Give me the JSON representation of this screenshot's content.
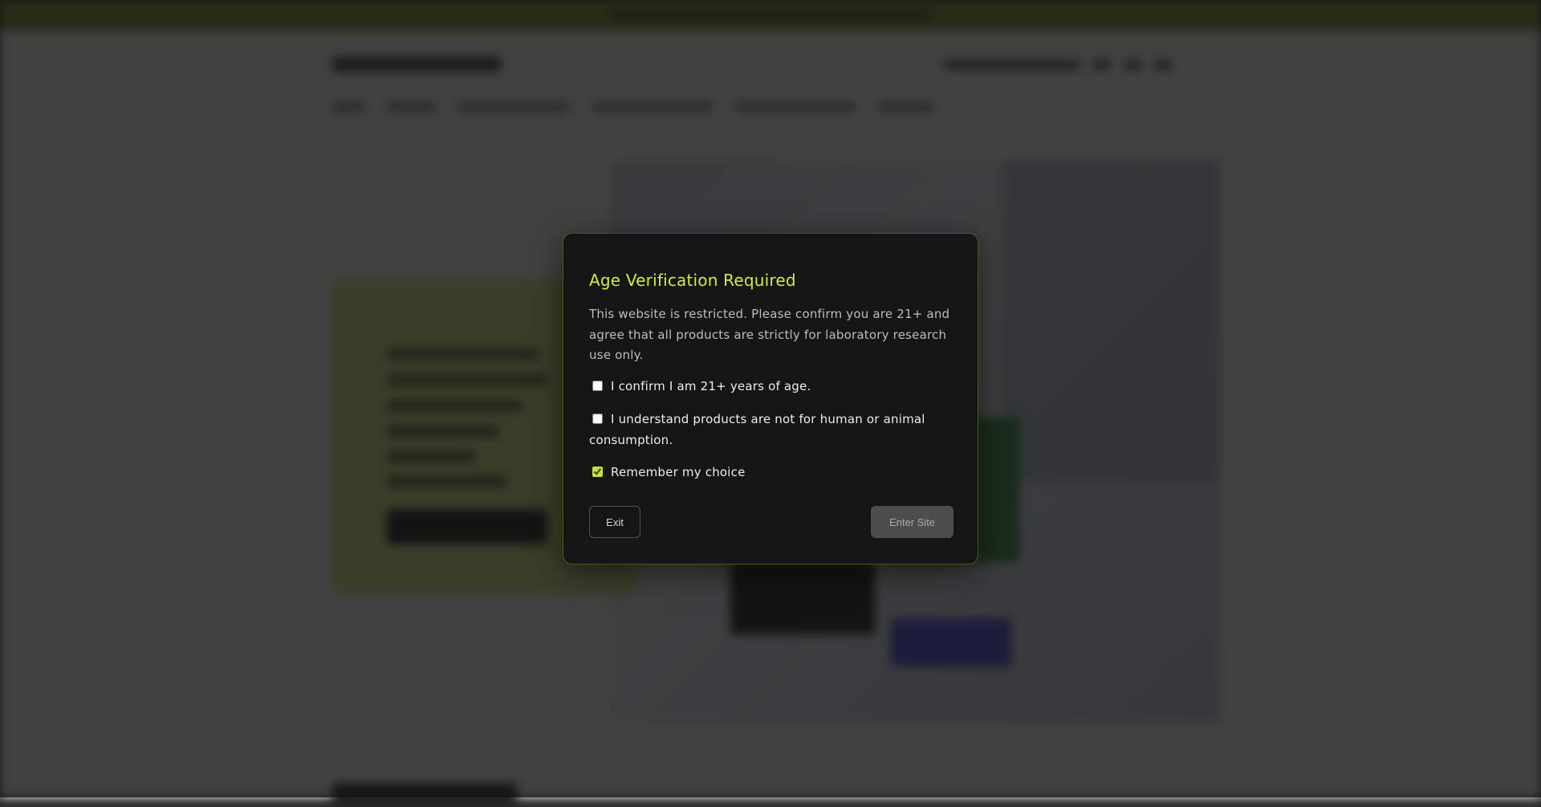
{
  "modal": {
    "title": "Age Verification Required",
    "body": "This website is restricted. Please confirm you are 21+ and agree that all products are strictly for laboratory research use only.",
    "checkboxes": [
      {
        "label": "I confirm I am 21+ years of age.",
        "checked": false
      },
      {
        "label": "I understand products are not for human or animal consumption.",
        "checked": false
      },
      {
        "label": "Remember my choice",
        "checked": true
      }
    ],
    "exit_label": "Exit",
    "enter_label": "Enter Site"
  },
  "colors": {
    "accent": "#d4ec3a",
    "modal_bg": "#151515",
    "modal_border": "#4a5a12",
    "enter_button_disabled": "#4d4d4d"
  }
}
